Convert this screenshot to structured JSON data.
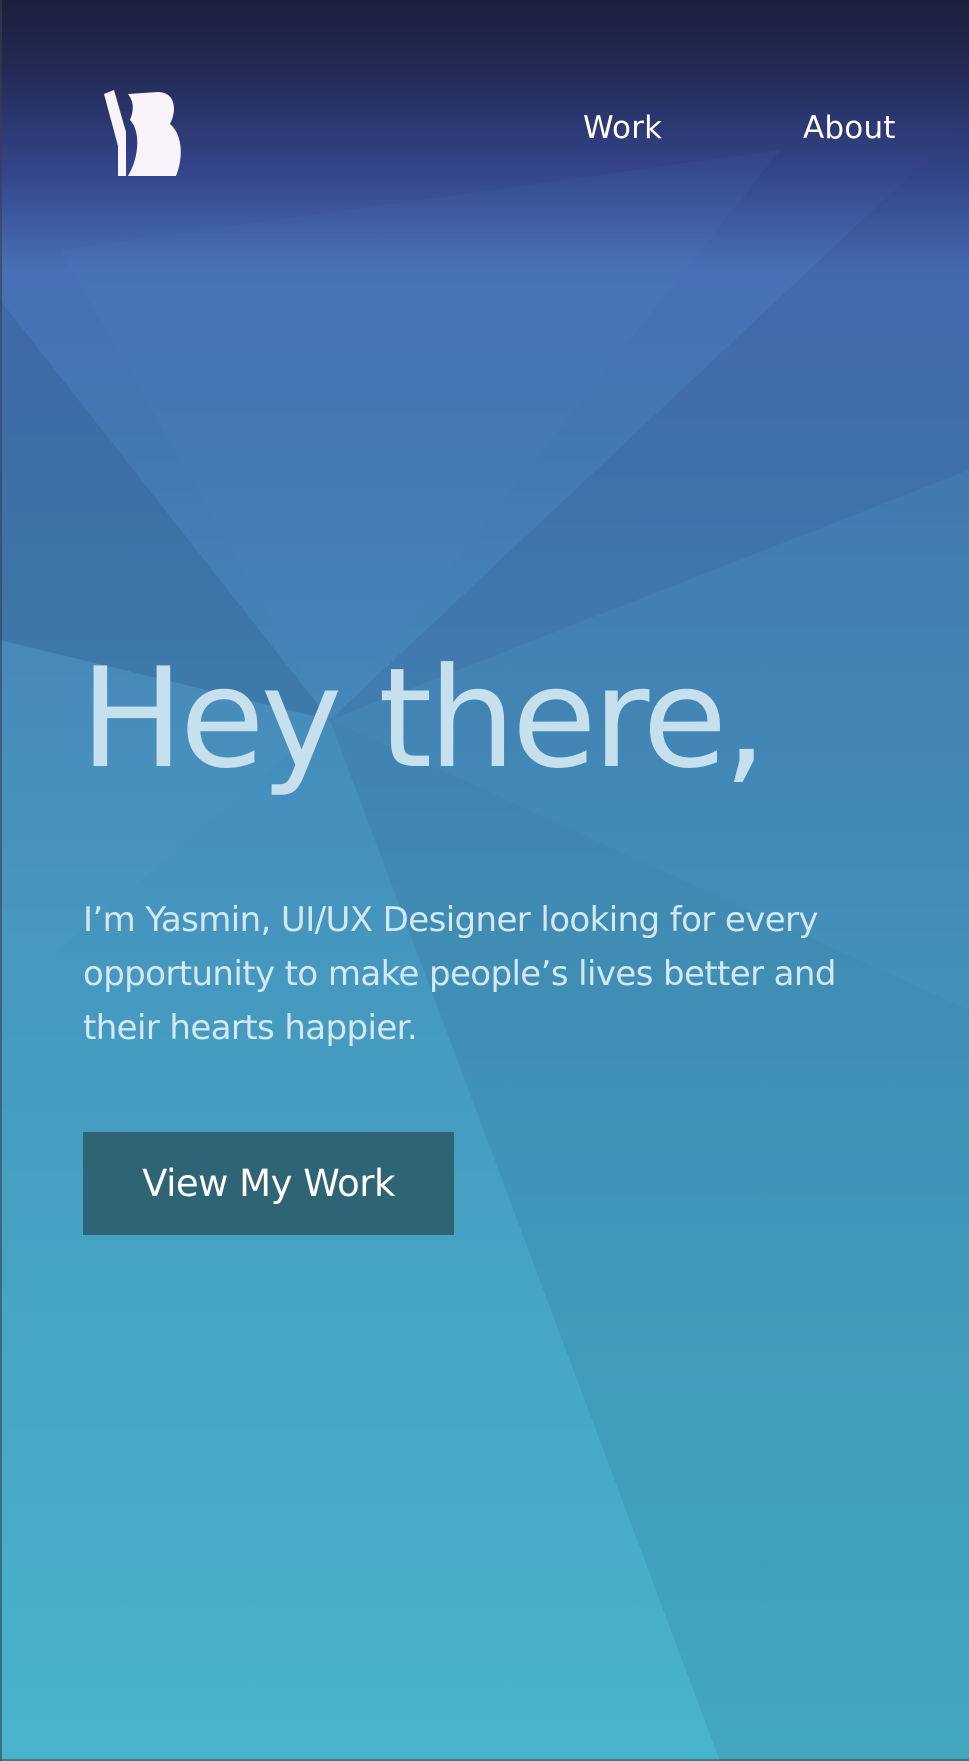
{
  "header": {
    "logo_label": "YB",
    "nav": {
      "work_label": "Work",
      "about_label": "About"
    }
  },
  "hero": {
    "title": "Hey there,",
    "body": "I’m Yasmin, UI/UX Designer looking for every opportunity to make people’s lives better and their hearts happier.",
    "cta_label": "View My Work"
  },
  "colors": {
    "background_top": "#1b1f3c",
    "background_mid": "#4478b2",
    "background_bottom": "#47b3ca",
    "title_text": "#c6e0ee",
    "body_text": "#d3e8f2",
    "cta_background": "#2e6474",
    "cta_text": "#ffffff",
    "nav_text": "#ffffff"
  }
}
